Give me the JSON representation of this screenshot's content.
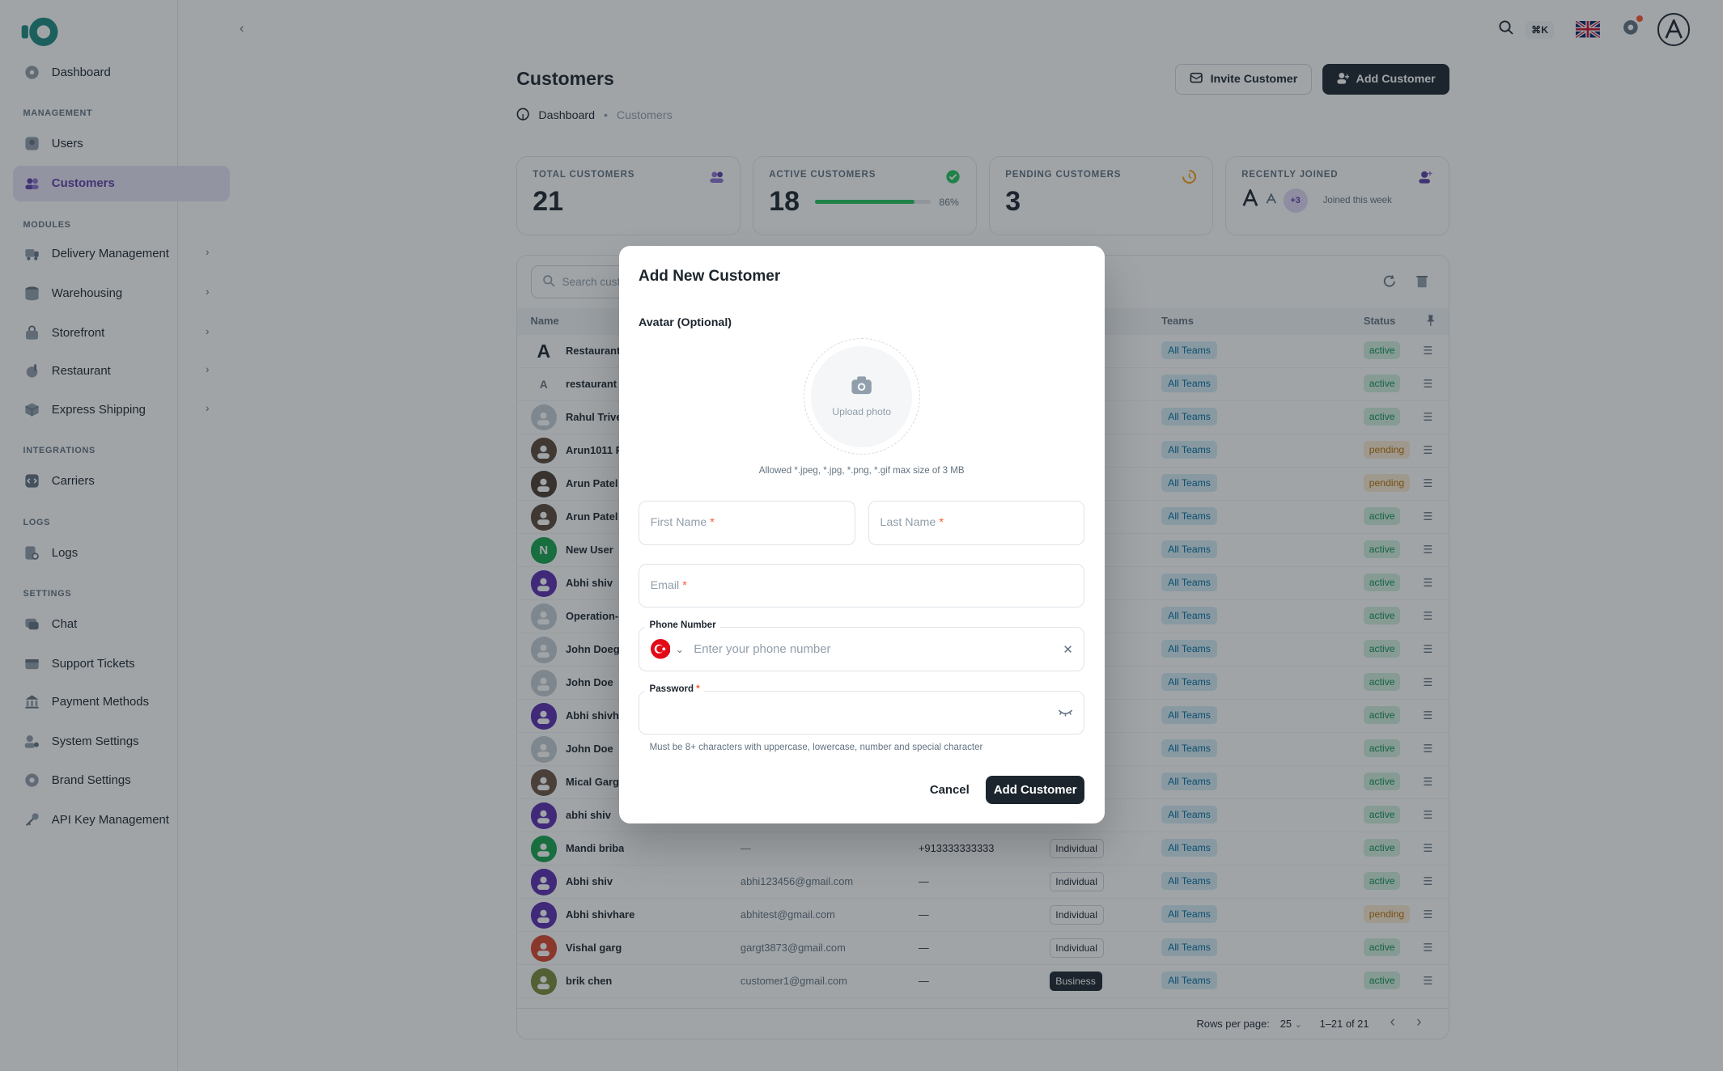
{
  "sidebar": {
    "dashboard": "Dashboard",
    "sections": {
      "management": "MANAGEMENT",
      "modules": "MODULES",
      "integrations": "INTEGRATIONS",
      "logs": "LOGS",
      "settings": "SETTINGS"
    },
    "items": {
      "users": "Users",
      "customers": "Customers",
      "delivery": "Delivery Management",
      "warehousing": "Warehousing",
      "storefront": "Storefront",
      "restaurant": "Restaurant",
      "express": "Express Shipping",
      "carriers": "Carriers",
      "logs": "Logs",
      "chat": "Chat",
      "support": "Support Tickets",
      "payment": "Payment Methods",
      "system": "System Settings",
      "brand": "Brand Settings",
      "api": "API Key Management"
    }
  },
  "topbar": {
    "shortcut": "⌘K"
  },
  "header": {
    "title": "Customers",
    "breadcrumb": [
      "Dashboard",
      "Customers"
    ],
    "invite_label": "Invite Customer",
    "add_label": "Add Customer"
  },
  "stats": {
    "total": {
      "label": "TOTAL CUSTOMERS",
      "value": "21"
    },
    "active": {
      "label": "ACTIVE CUSTOMERS",
      "value": "18",
      "percent_text": "86%",
      "fraction": 0.86
    },
    "pending": {
      "label": "PENDING CUSTOMERS",
      "value": "3"
    },
    "recent": {
      "label": "RECENTLY JOINED",
      "extra": "+3",
      "caption": "Joined this week"
    }
  },
  "table": {
    "search_placeholder": "Search cust",
    "headers": {
      "name": "Name",
      "teams": "Teams",
      "status": "Status"
    },
    "rows": [
      {
        "name": "Restaurant",
        "email": "",
        "phone": "",
        "type": "",
        "team": "All Teams",
        "status": "active"
      },
      {
        "name": "restaurant",
        "email": "",
        "phone": "",
        "type": "",
        "team": "All Teams",
        "status": "active"
      },
      {
        "name": "Rahul Trive",
        "email": "",
        "phone": "",
        "type": "",
        "team": "All Teams",
        "status": "active"
      },
      {
        "name": "Arun1011 P",
        "email": "",
        "phone": "",
        "type": "",
        "team": "All Teams",
        "status": "pending"
      },
      {
        "name": "Arun Patel",
        "email": "",
        "phone": "",
        "type": "",
        "team": "All Teams",
        "status": "pending"
      },
      {
        "name": "Arun Patel",
        "email": "",
        "phone": "",
        "type": "",
        "team": "All Teams",
        "status": "active"
      },
      {
        "name": "New User",
        "email": "",
        "phone": "",
        "type": "",
        "team": "All Teams",
        "status": "active"
      },
      {
        "name": "Abhi shiv",
        "email": "",
        "phone": "",
        "type": "",
        "team": "All Teams",
        "status": "active"
      },
      {
        "name": "Operation-",
        "email": "",
        "phone": "",
        "type": "",
        "team": "All Teams",
        "status": "active"
      },
      {
        "name": "John Doeg",
        "email": "",
        "phone": "",
        "type": "",
        "team": "All Teams",
        "status": "active"
      },
      {
        "name": "John Doe",
        "email": "",
        "phone": "",
        "type": "",
        "team": "All Teams",
        "status": "active"
      },
      {
        "name": "Abhi shivha",
        "email": "",
        "phone": "",
        "type": "",
        "team": "All Teams",
        "status": "active"
      },
      {
        "name": "John Doe",
        "email": "",
        "phone": "",
        "type": "",
        "team": "All Teams",
        "status": "active"
      },
      {
        "name": "Mical Garg",
        "email": "",
        "phone": "",
        "type": "",
        "team": "All Teams",
        "status": "active"
      },
      {
        "name": "abhi shiv",
        "email": "",
        "phone": "",
        "type": "",
        "team": "All Teams",
        "status": "active"
      },
      {
        "name": "Mandi briba",
        "email": "—",
        "phone": "+913333333333",
        "type": "Individual",
        "team": "All Teams",
        "status": "active"
      },
      {
        "name": "Abhi shiv",
        "email": "abhi123456@gmail.com",
        "phone": "—",
        "type": "Individual",
        "team": "All Teams",
        "status": "active"
      },
      {
        "name": "Abhi shivhare",
        "email": "abhitest@gmail.com",
        "phone": "—",
        "type": "Individual",
        "team": "All Teams",
        "status": "pending"
      },
      {
        "name": "Vishal garg",
        "email": "gargt3873@gmail.com",
        "phone": "—",
        "type": "Individual",
        "team": "All Teams",
        "status": "active"
      },
      {
        "name": "brik chen",
        "email": "customer1@gmail.com",
        "phone": "—",
        "type": "Business",
        "team": "All Teams",
        "status": "active"
      }
    ],
    "footer": {
      "rows_per_page_label": "Rows per page:",
      "rows_per_page": "25",
      "range": "1–21 of 21"
    }
  },
  "modal": {
    "title": "Add New Customer",
    "avatar_label": "Avatar (Optional)",
    "upload_label": "Upload photo",
    "allowed": "Allowed *.jpeg, *.jpg, *.png, *.gif max size of 3 MB",
    "first_name": "First Name",
    "last_name": "Last Name",
    "email": "Email",
    "phone_label": "Phone Number",
    "phone_placeholder": "Enter your phone number",
    "password_label": "Password",
    "required_mark": "*",
    "password_hint": "Must be 8+ characters with uppercase, lowercase, number and special character",
    "cancel": "Cancel",
    "submit": "Add Customer"
  },
  "colors": {
    "accent": "#5b3ea8",
    "dark": "#1c252e",
    "success": "#22c55e",
    "flag_red": "#e30a17"
  }
}
